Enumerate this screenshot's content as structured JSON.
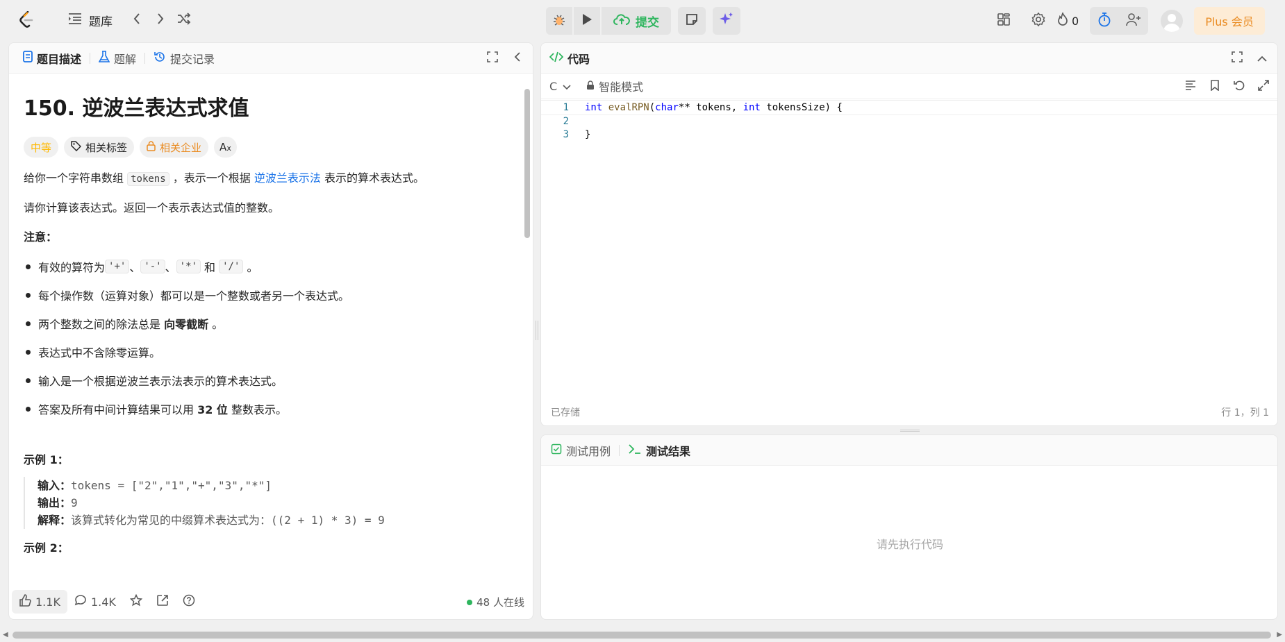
{
  "nav": {
    "problemset_label": "题库",
    "submit_label": "提交",
    "fire_count": "0",
    "plus_label": "Plus 会员"
  },
  "desc_tabs": [
    {
      "label": "题目描述",
      "icon": "document-icon"
    },
    {
      "label": "题解",
      "icon": "flask-icon"
    },
    {
      "label": "提交记录",
      "icon": "history-icon"
    }
  ],
  "problem": {
    "title": "150. 逆波兰表达式求值",
    "difficulty": "中等",
    "tag_related": "相关标签",
    "tag_company": "相关企业",
    "p1_a": "给你一个字符串数组 ",
    "p1_code": "tokens",
    "p1_b": " ，表示一个根据 ",
    "p1_link": "逆波兰表示法",
    "p1_c": " 表示的算术表达式。",
    "p2": "请你计算该表达式。返回一个表示表达式值的整数。",
    "note_title": "注意：",
    "li1_a": "有效的算符为 ",
    "li1_ops": [
      "'+'",
      "'-'",
      "'*'",
      "'/'"
    ],
    "li1_sep1": "、",
    "li1_and": " 和 ",
    "li1_end": " 。",
    "li2": "每个操作数（运算对象）都可以是一个整数或者另一个表达式。",
    "li3_a": "两个整数之间的除法总是 ",
    "li3_b": "向零截断",
    "li3_c": " 。",
    "li4": "表达式中不含除零运算。",
    "li5": "输入是一个根据逆波兰表示法表示的算术表达式。",
    "li6_a": "答案及所有中间计算结果可以用 ",
    "li6_b": "32 位",
    "li6_c": " 整数表示。",
    "ex1_title": "示例 1：",
    "ex1_in_label": "输入：",
    "ex1_in": "tokens = [\"2\",\"1\",\"+\",\"3\",\"*\"]",
    "ex1_out_label": "输出：",
    "ex1_out": "9",
    "ex1_exp_label": "解释：",
    "ex1_exp_text": "该算式转化为常见的中缀算术表达式为：",
    "ex1_exp_code": "((2 + 1) * 3) = 9",
    "ex2_title": "示例 2："
  },
  "desc_footer": {
    "likes": "1.1K",
    "comments": "1.4K",
    "online": "48 人在线"
  },
  "code_panel": {
    "title": "代码",
    "language": "C",
    "mode": "智能模式",
    "lines": [
      {
        "n": "1",
        "parts": [
          [
            "kw",
            "int"
          ],
          [
            "",
            ""
          ],
          [
            "fn",
            " evalRPN"
          ],
          [
            "",
            "("
          ],
          [
            "kw",
            "char"
          ],
          [
            "",
            "** tokens, "
          ],
          [
            "kw",
            "int"
          ],
          [
            "",
            " tokensSize) {"
          ]
        ]
      },
      {
        "n": "2",
        "parts": []
      },
      {
        "n": "3",
        "parts": [
          [
            "",
            "}"
          ]
        ]
      }
    ],
    "status_saved": "已存储",
    "status_pos": "行 1，列 1"
  },
  "test_panel": {
    "tab_cases": "测试用例",
    "tab_result": "测试结果",
    "placeholder": "请先执行代码"
  },
  "colors": {
    "accent_green": "#2db55d",
    "medium": "#ffb800",
    "plus": "#ea8c23",
    "link": "#1a73e8"
  }
}
